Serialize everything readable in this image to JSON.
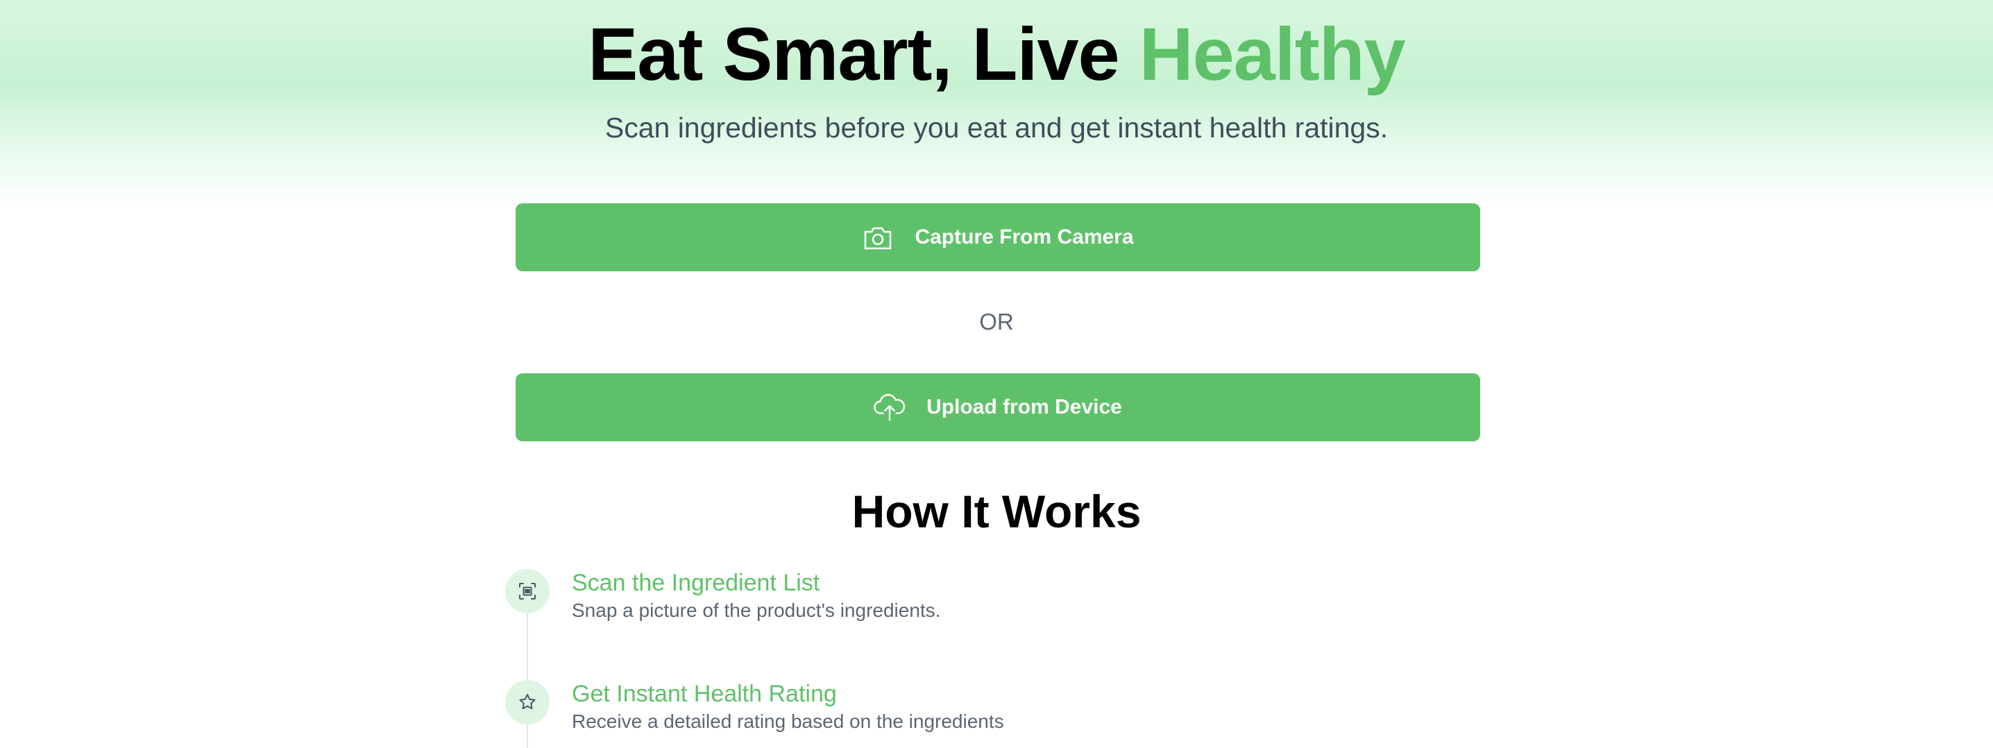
{
  "hero": {
    "title_main": "Eat Smart, Live ",
    "title_accent": "Healthy",
    "subtitle": "Scan ingredients before you eat and get instant health ratings."
  },
  "actions": {
    "camera_label": "Capture From Camera",
    "camera_icon": "camera-icon",
    "or_label": "OR",
    "upload_label": "Upload from Device",
    "upload_icon": "cloud-upload-icon"
  },
  "how_it_works": {
    "title": "How It Works",
    "steps": [
      {
        "icon": "scan-icon",
        "title": "Scan the Ingredient List",
        "description": "Snap a picture of the product's ingredients."
      },
      {
        "icon": "star-icon",
        "title": "Get Instant Health Rating",
        "description": "Receive a detailed rating based on the ingredients"
      }
    ]
  },
  "colors": {
    "accent": "#5ec169",
    "icon_bg": "#dff5e4",
    "text_muted": "#5b6673"
  }
}
